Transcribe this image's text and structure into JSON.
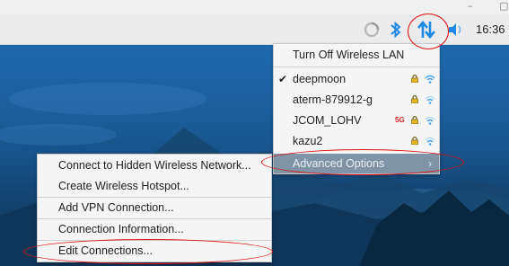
{
  "window": {
    "minimize_icon": "minimize-icon",
    "restore_icon": "restore-icon"
  },
  "panel": {
    "clock": "16:36",
    "icons": [
      "network-status-icon",
      "bluetooth-icon",
      "network-transfer-icon",
      "volume-icon"
    ]
  },
  "network_menu": {
    "toggle_label": "Turn Off Wireless LAN",
    "networks": [
      {
        "ssid": "deepmoon",
        "connected": true,
        "secured": true,
        "band_5g": false
      },
      {
        "ssid": "aterm-879912-g",
        "connected": false,
        "secured": true,
        "band_5g": false
      },
      {
        "ssid": "JCOM_LOHV",
        "connected": false,
        "secured": true,
        "band_5g": true,
        "band_label": "5G"
      },
      {
        "ssid": "kazu2",
        "connected": false,
        "secured": true,
        "band_5g": false
      }
    ],
    "advanced_label": "Advanced Options",
    "advanced_arrow": "›"
  },
  "advanced_menu": {
    "items": [
      "Connect to Hidden Wireless Network...",
      "Create Wireless Hotspot...",
      "Add VPN Connection...",
      "Connection Information...",
      "Edit Connections..."
    ]
  },
  "colors": {
    "highlight_ring": "#d11111",
    "advanced_bg": "#7f94a6",
    "accent_blue": "#1e88e5"
  }
}
